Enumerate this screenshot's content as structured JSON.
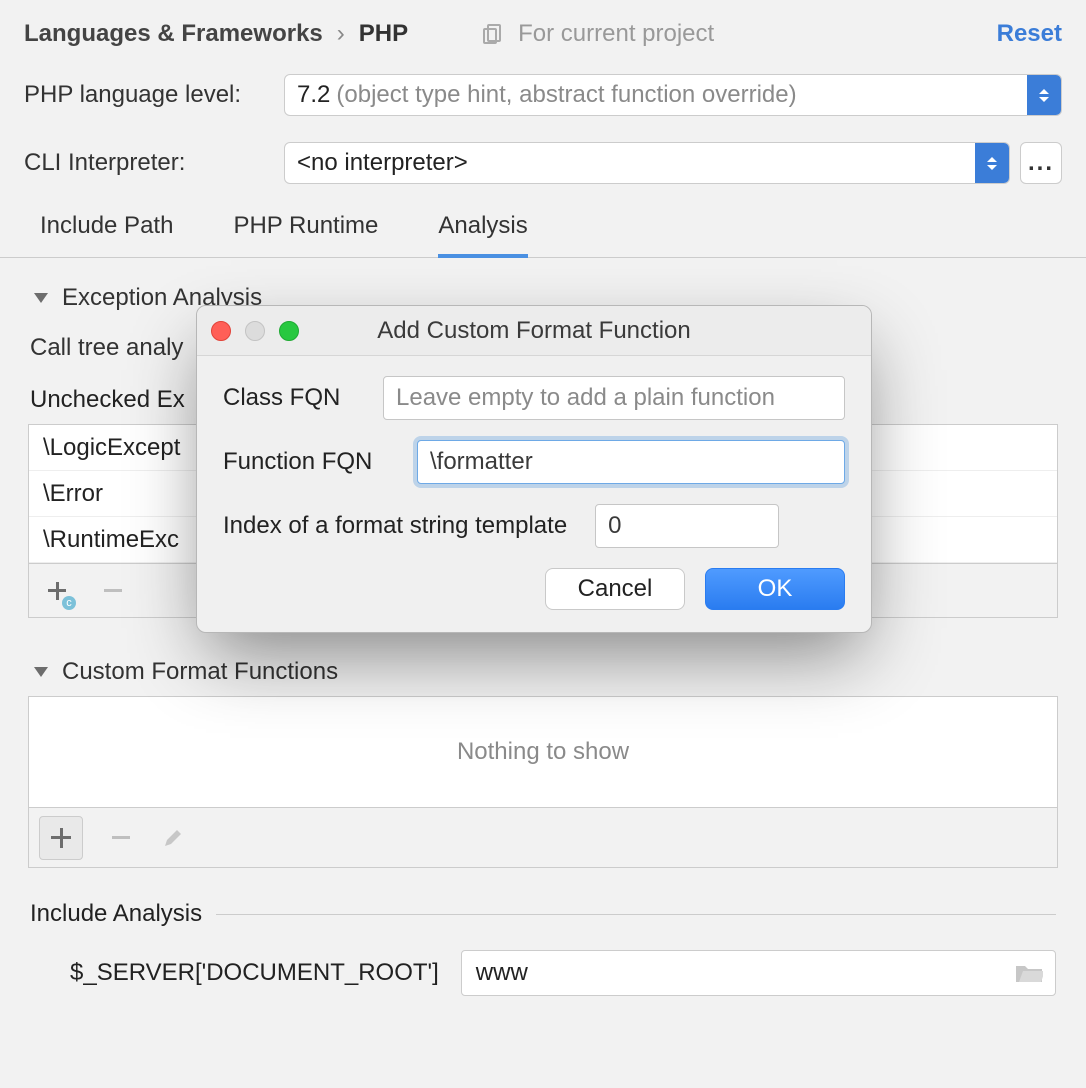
{
  "breadcrumb": {
    "parent": "Languages & Frameworks",
    "child": "PHP",
    "separator": "›"
  },
  "scope": "For current project",
  "reset": "Reset",
  "php_level": {
    "label": "PHP language level:",
    "value": "7.2",
    "hint": "(object type hint, abstract function override)"
  },
  "cli": {
    "label": "CLI Interpreter:",
    "value": "<no interpreter>"
  },
  "tabs": {
    "a": "Include Path",
    "b": "PHP Runtime",
    "c": "Analysis"
  },
  "exception_section": "Exception Analysis",
  "call_tree_label": "Call tree analy",
  "unchecked_label": "Unchecked Ex",
  "exceptions": {
    "r0": "\\LogicExcept",
    "r1": "\\Error",
    "r2": "\\RuntimeExc"
  },
  "cff_section": "Custom Format Functions",
  "cff_empty": "Nothing to show",
  "include_section": "Include Analysis",
  "include_label": "$_SERVER['DOCUMENT_ROOT']",
  "include_value": "www",
  "dialog": {
    "title": "Add Custom Format Function",
    "class_fqn_label": "Class FQN",
    "class_fqn_placeholder": "Leave empty to add a plain function",
    "func_fqn_label": "Function FQN",
    "func_fqn_value": "\\formatter",
    "index_label": "Index of a format string template",
    "index_value": "0",
    "cancel": "Cancel",
    "ok": "OK"
  }
}
